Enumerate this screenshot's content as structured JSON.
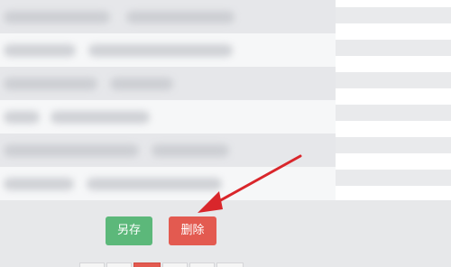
{
  "actions": {
    "save_label": "另存",
    "delete_label": "删除"
  },
  "colors": {
    "save_button": "#5cb87a",
    "delete_button": "#e35a50",
    "annotation_arrow": "#d9262b"
  },
  "icons": {
    "annotation": "red-arrow-icon"
  }
}
